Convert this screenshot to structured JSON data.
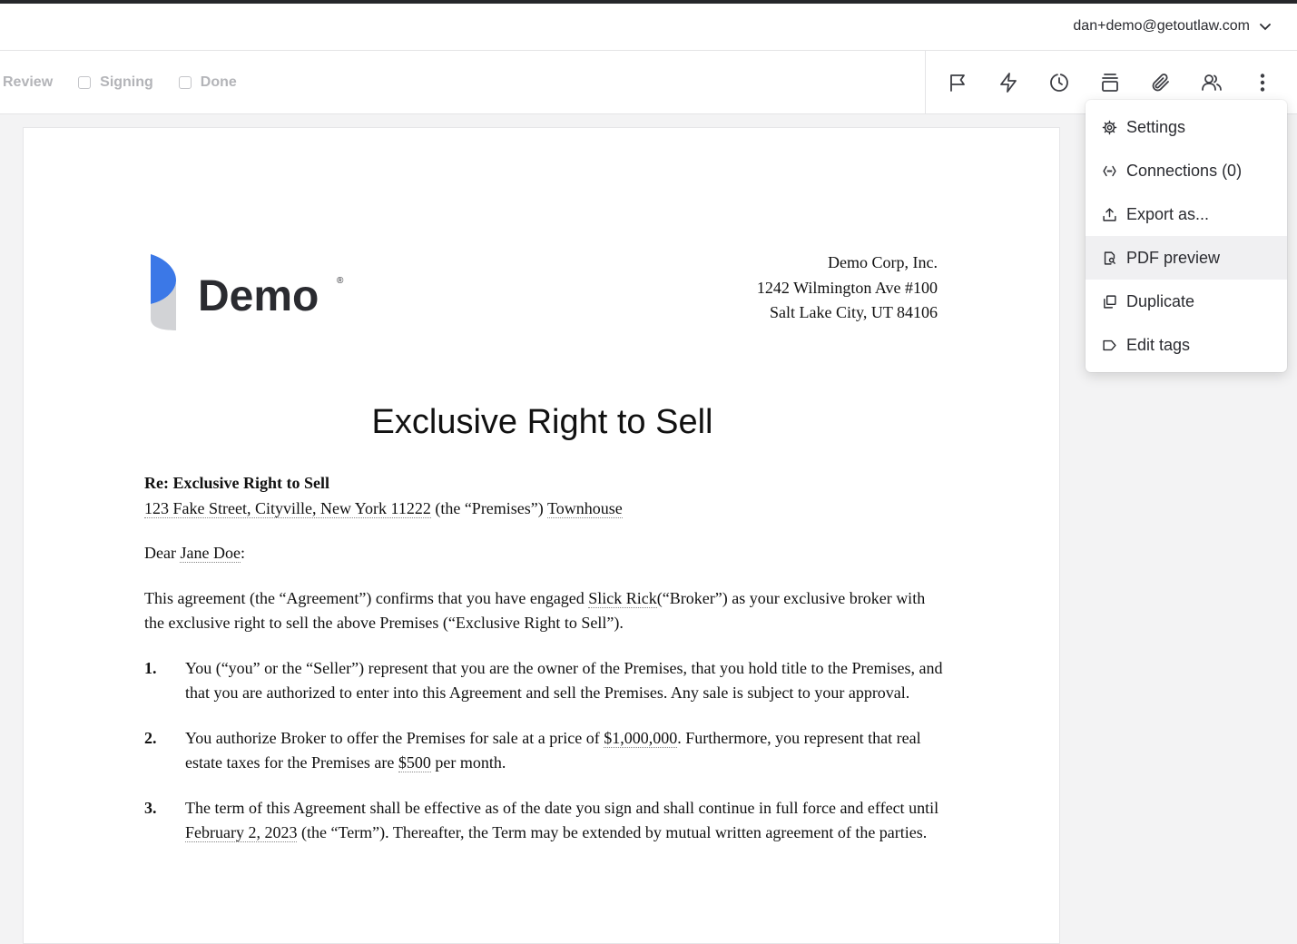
{
  "header": {
    "account_email": "dan+demo@getoutlaw.com"
  },
  "workflow": {
    "steps": [
      "Review",
      "Signing",
      "Done"
    ]
  },
  "toolbar": {
    "icons": [
      "flag-icon",
      "lightning-icon",
      "history-icon",
      "stack-icon",
      "paperclip-icon",
      "users-icon",
      "more-vertical-icon"
    ]
  },
  "menu": {
    "items": [
      {
        "label": "Settings",
        "icon": "gear-icon"
      },
      {
        "label": "Connections (0)",
        "icon": "link-icon"
      },
      {
        "label": "Export as...",
        "icon": "upload-icon"
      },
      {
        "label": "PDF preview",
        "icon": "pdf-preview-icon",
        "active": true
      },
      {
        "label": "Duplicate",
        "icon": "duplicate-icon"
      },
      {
        "label": "Edit tags",
        "icon": "tag-icon"
      }
    ]
  },
  "document": {
    "logo_text": "Demo",
    "logo_mark": "®",
    "company": [
      "Demo Corp, Inc.",
      "1242 Wilmington Ave #100",
      "Salt Lake City, UT 84106"
    ],
    "title": "Exclusive Right to Sell",
    "re_line": "Re: Exclusive Right to Sell",
    "premises_address": "123 Fake Street, Cityville, New York 11222",
    "premises_mid": " (the “Premises”) ",
    "premises_type": "Townhouse",
    "salutation_pre": "Dear ",
    "client_name": "Jane Doe",
    "salutation_post": ":",
    "intro_pre": "This agreement (the “Agreement”) confirms that you have engaged ",
    "broker_name": "Slick Rick",
    "intro_post": "(“Broker”) as your exclusive broker with the exclusive right to sell the above Premises (“Exclusive Right to Sell”).",
    "item1_num": "1.",
    "item1": "You (“you” or the “Seller”) represent that you are the owner of the Premises, that you hold title to the Premises, and that you are authorized to enter into this Agreement and sell the Premises.  Any sale is subject to your approval.",
    "item2_num": "2.",
    "item2_pre": "You authorize Broker to offer the Premises for sale at a price of ",
    "price": "$1,000,000",
    "item2_mid": ".  Furthermore, you represent that real estate taxes for the Premises are ",
    "taxes": "$500",
    "item2_post": " per month.",
    "item3_num": "3.",
    "item3_pre": "The term of this Agreement shall be effective as of the date you sign and shall continue in full force and effect until ",
    "term_date": "February 2, 2023",
    "item3_post": " (the “Term”). Thereafter, the Term may be extended by mutual written agreement of the parties."
  }
}
